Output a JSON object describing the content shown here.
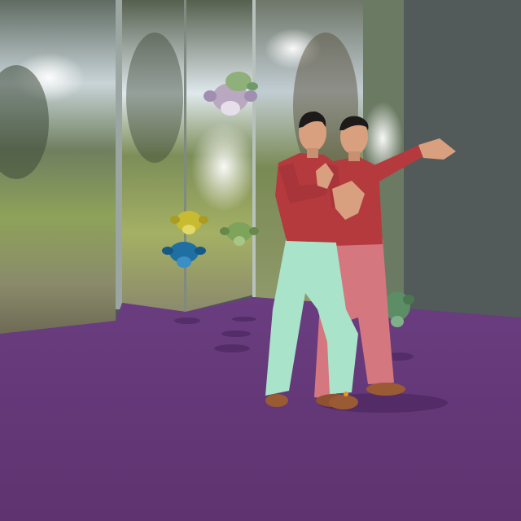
{
  "scene": {
    "colors": {
      "floor": "#65397a",
      "floor_dark": "#4f2b63",
      "wall_gray": "#505a59",
      "sky_light": "#d9e3ea",
      "foliage": "#4f6a35",
      "grass": "#93a65a",
      "sweater": "#b53a3e",
      "pants_front": "#a9e3c9",
      "pants_back": "#d4777f",
      "skin": "#d9a07f",
      "hair": "#1d1a19",
      "shoe": "#9a5a34"
    },
    "objects": [
      {
        "id": "figure-front",
        "kind": "human-figure"
      },
      {
        "id": "figure-back",
        "kind": "human-figure"
      },
      {
        "id": "monkey-head-silver",
        "kind": "monkey-head",
        "color": "#b9a8c0"
      },
      {
        "id": "monkey-head-green-top",
        "kind": "monkey-head",
        "color": "#8fb07a"
      },
      {
        "id": "monkey-head-yellow",
        "kind": "monkey-head",
        "color": "#c8bb32"
      },
      {
        "id": "monkey-head-blue",
        "kind": "monkey-head",
        "color": "#1f6fa2"
      },
      {
        "id": "monkey-head-green-mid",
        "kind": "monkey-head",
        "color": "#7ea35a"
      },
      {
        "id": "monkey-head-green-low",
        "kind": "monkey-head",
        "color": "#5c8d64"
      }
    ]
  }
}
